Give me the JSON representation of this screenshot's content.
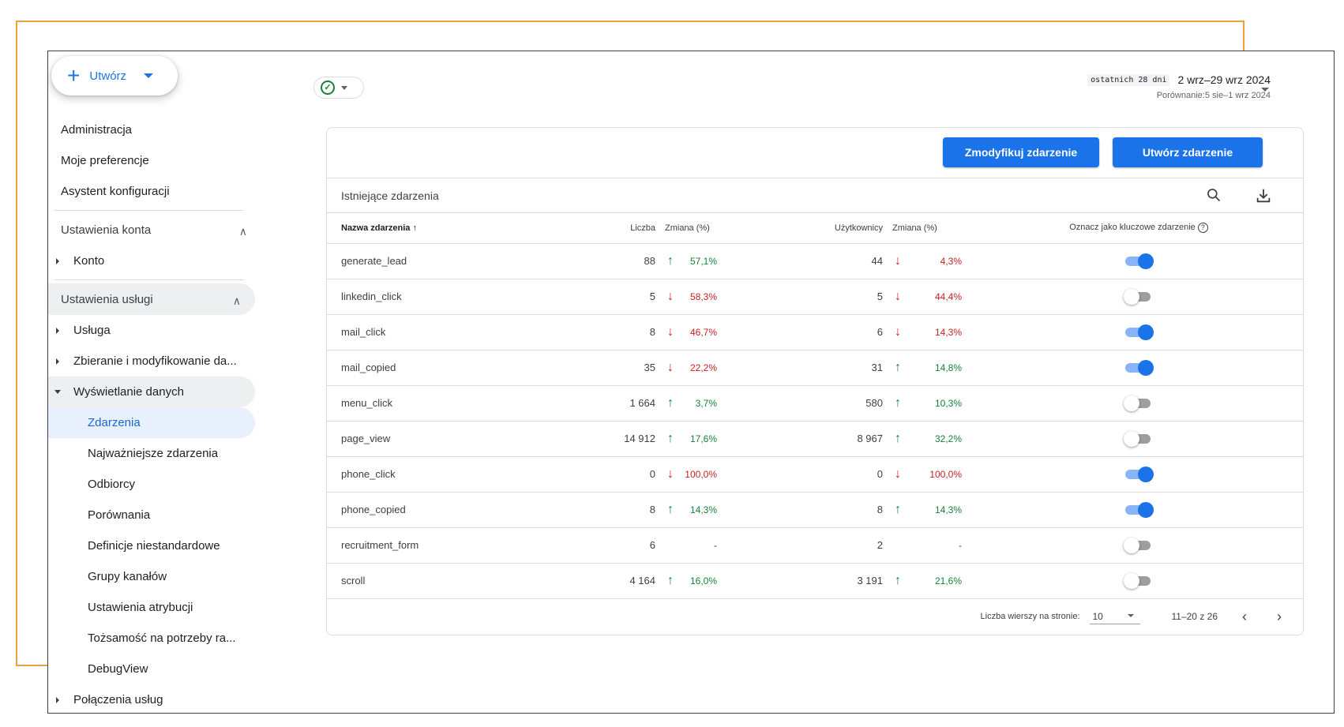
{
  "create_button": {
    "label": "Utwórz"
  },
  "sidebar": {
    "top_items": [
      "Administracja",
      "Moje preferencje",
      "Asystent konfiguracji"
    ],
    "account_section": {
      "title": "Ustawienia konta",
      "items": [
        "Konto"
      ]
    },
    "property_section": {
      "title": "Ustawienia usługi",
      "items": [
        "Usługa",
        "Zbieranie i modyfikowanie da...",
        "Wyświetlanie danych"
      ],
      "subitems": [
        "Zdarzenia",
        "Najważniejsze zdarzenia",
        "Odbiorcy",
        "Porównania",
        "Definicje niestandardowe",
        "Grupy kanałów",
        "Ustawienia atrybucji",
        "Tożsamość na potrzeby ra...",
        "DebugView"
      ],
      "after_items": [
        "Połączenia usług"
      ],
      "selected": "Zdarzenia"
    }
  },
  "date_range": {
    "period": "ostatnich 28 dni",
    "range": "2 wrz–29 wrz 2024",
    "compare": "Porównanie:5 sie–1 wrz 2024"
  },
  "toolbar": {
    "modify_label": "Zmodyfikuj zdarzenie",
    "create_label": "Utwórz zdarzenie"
  },
  "table": {
    "title": "Istniejące zdarzenia",
    "columns": {
      "name": "Nazwa zdarzenia",
      "count": "Liczba",
      "count_change": "Zmiana (%)",
      "users": "Użytkownicy",
      "users_change": "Zmiana (%)",
      "key_event": "Oznacz jako kluczowe zdarzenie"
    },
    "rows": [
      {
        "name": "generate_lead",
        "count": "88",
        "count_dir": "up",
        "count_change": "57,1%",
        "users": "44",
        "users_dir": "down",
        "users_change": "4,3%",
        "key": true
      },
      {
        "name": "linkedin_click",
        "count": "5",
        "count_dir": "down",
        "count_change": "58,3%",
        "users": "5",
        "users_dir": "down",
        "users_change": "44,4%",
        "key": false
      },
      {
        "name": "mail_click",
        "count": "8",
        "count_dir": "down",
        "count_change": "46,7%",
        "users": "6",
        "users_dir": "down",
        "users_change": "14,3%",
        "key": true
      },
      {
        "name": "mail_copied",
        "count": "35",
        "count_dir": "down",
        "count_change": "22,2%",
        "users": "31",
        "users_dir": "up",
        "users_change": "14,8%",
        "key": true
      },
      {
        "name": "menu_click",
        "count": "1 664",
        "count_dir": "up",
        "count_change": "3,7%",
        "users": "580",
        "users_dir": "up",
        "users_change": "10,3%",
        "key": false
      },
      {
        "name": "page_view",
        "count": "14 912",
        "count_dir": "up",
        "count_change": "17,6%",
        "users": "8 967",
        "users_dir": "up",
        "users_change": "32,2%",
        "key": false
      },
      {
        "name": "phone_click",
        "count": "0",
        "count_dir": "down",
        "count_change": "100,0%",
        "users": "0",
        "users_dir": "down",
        "users_change": "100,0%",
        "key": true
      },
      {
        "name": "phone_copied",
        "count": "8",
        "count_dir": "up",
        "count_change": "14,3%",
        "users": "8",
        "users_dir": "up",
        "users_change": "14,3%",
        "key": true
      },
      {
        "name": "recruitment_form",
        "count": "6",
        "count_dir": "none",
        "count_change": "-",
        "users": "2",
        "users_dir": "none",
        "users_change": "-",
        "key": false
      },
      {
        "name": "scroll",
        "count": "4 164",
        "count_dir": "up",
        "count_change": "16,0%",
        "users": "3 191",
        "users_dir": "up",
        "users_change": "21,6%",
        "key": false
      }
    ]
  },
  "pagination": {
    "rows_label": "Liczba wierszy na stronie:",
    "rows_value": "10",
    "range": "11–20 z 26"
  },
  "colors": {
    "primary": "#1a73e8",
    "up": "#188038",
    "down": "#c5221f",
    "frame": "#e8a33d"
  }
}
